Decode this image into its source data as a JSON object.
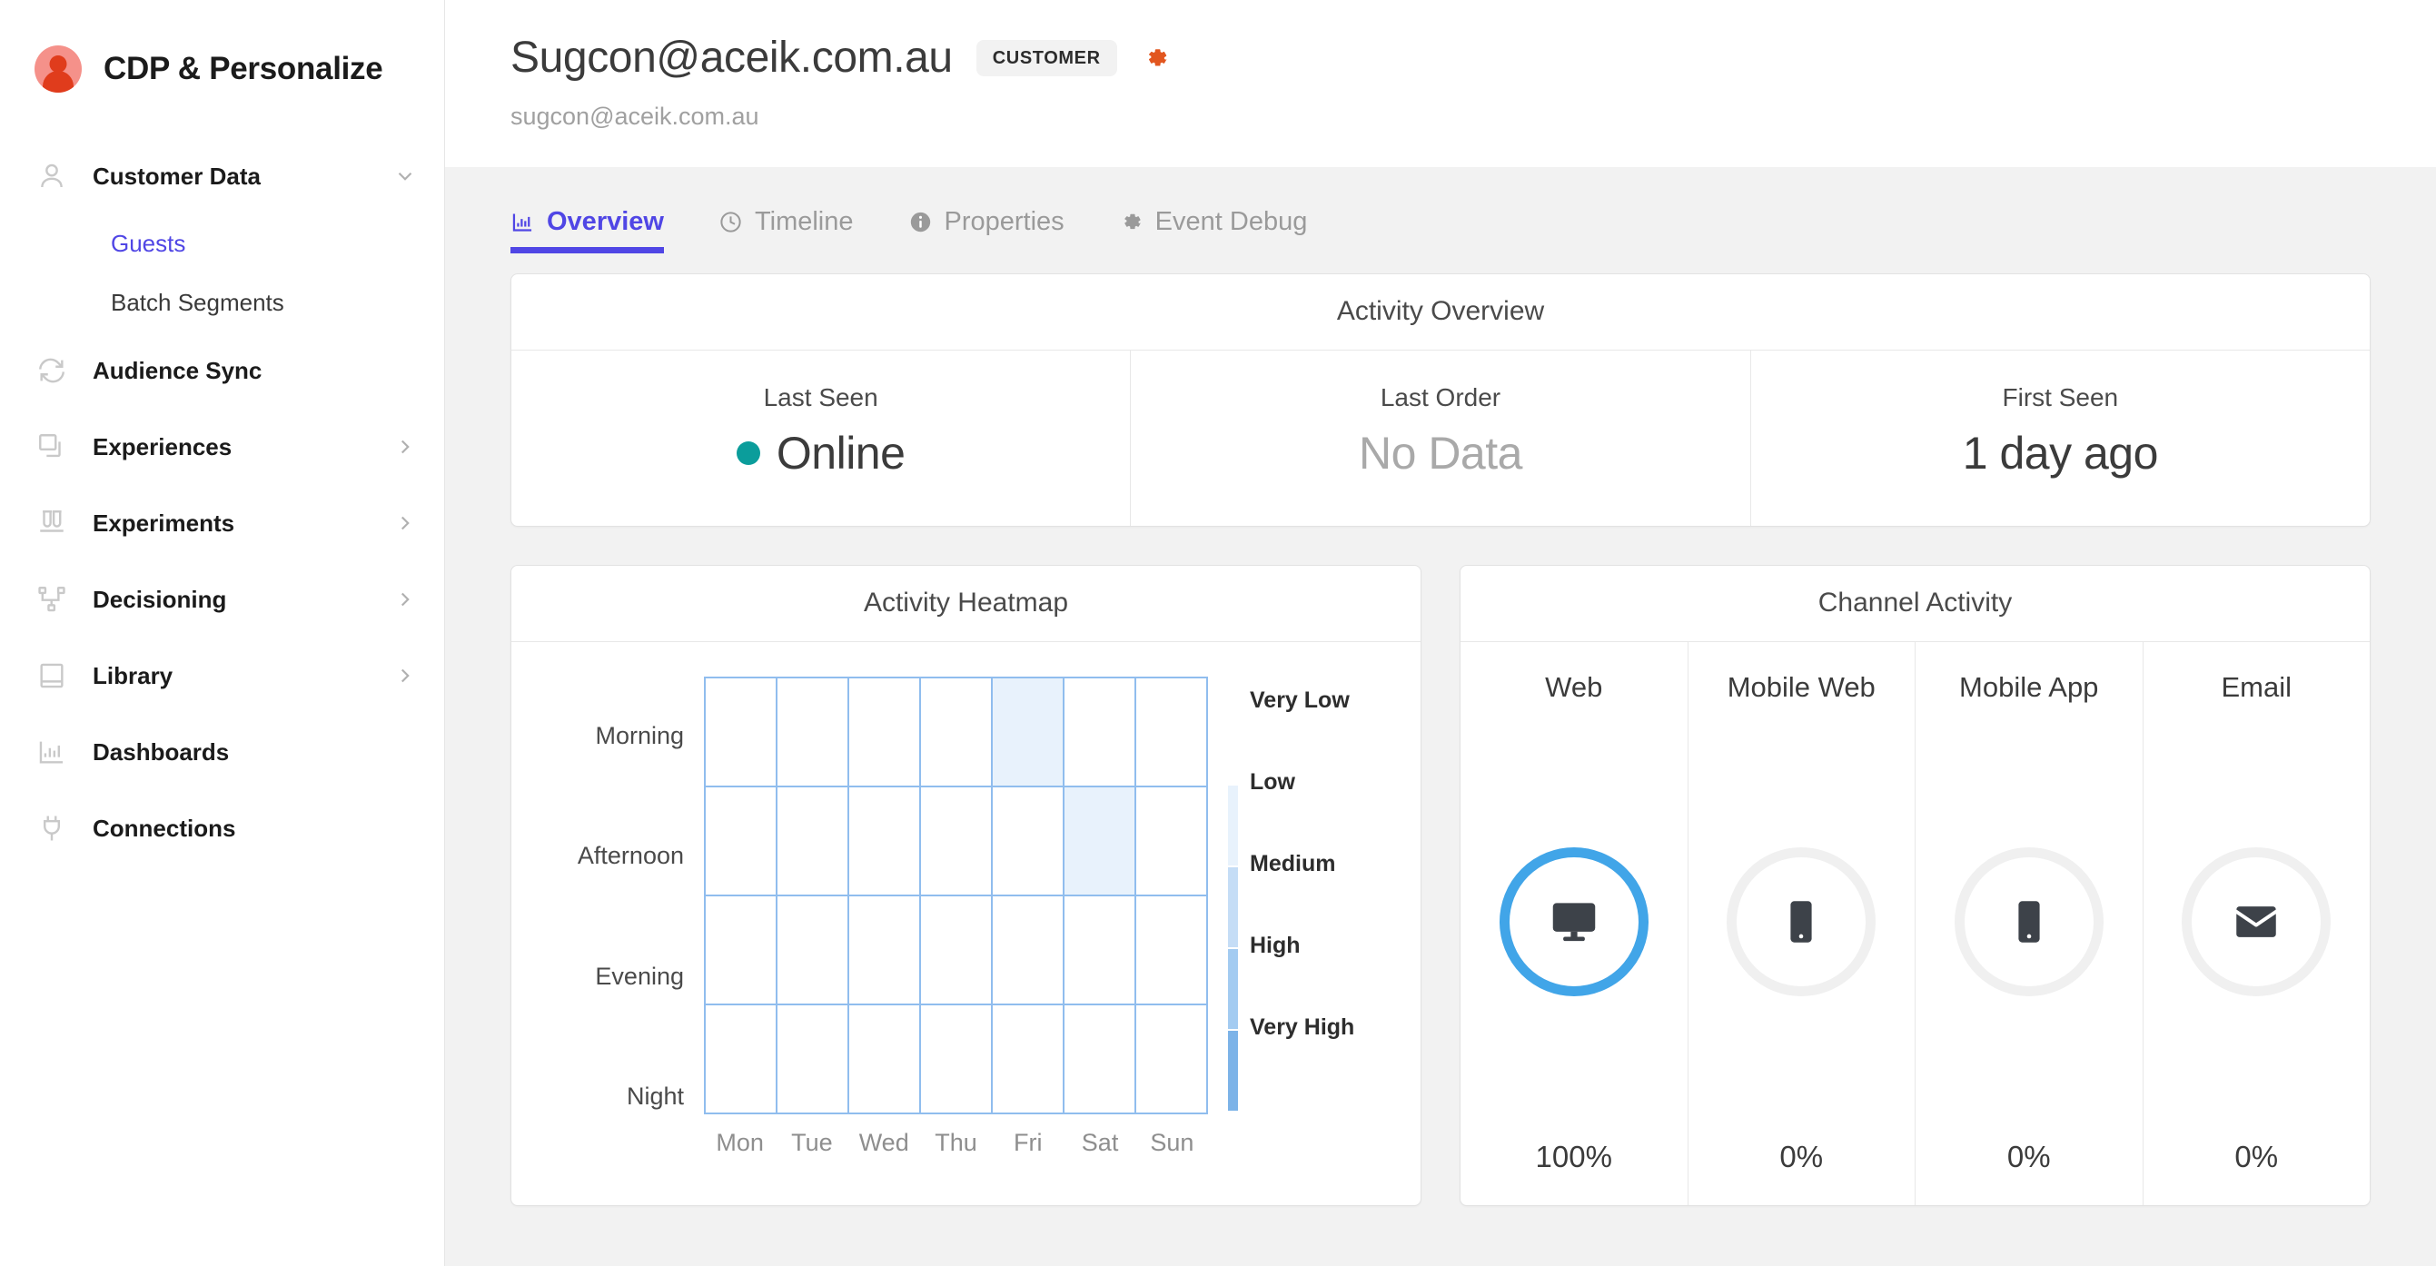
{
  "brand": {
    "name": "CDP & Personalize",
    "logo_icon": "person-in-circle-logo"
  },
  "sidebar": {
    "items": [
      {
        "label": "Customer Data",
        "icon": "user-icon",
        "chevron": "chevron-down-icon",
        "expanded": true
      },
      {
        "label": "Audience Sync",
        "icon": "sync-icon",
        "chevron": null
      },
      {
        "label": "Experiences",
        "icon": "layers-icon",
        "chevron": "chevron-right-icon"
      },
      {
        "label": "Experiments",
        "icon": "test-tubes-icon",
        "chevron": "chevron-right-icon"
      },
      {
        "label": "Decisioning",
        "icon": "node-tree-icon",
        "chevron": "chevron-right-icon"
      },
      {
        "label": "Library",
        "icon": "book-icon",
        "chevron": "chevron-right-icon"
      },
      {
        "label": "Dashboards",
        "icon": "bar-chart-icon",
        "chevron": null
      },
      {
        "label": "Connections",
        "icon": "plug-icon",
        "chevron": null
      }
    ],
    "sub_items": [
      {
        "label": "Guests",
        "active": true
      },
      {
        "label": "Batch Segments",
        "active": false
      }
    ]
  },
  "header": {
    "title": "Sugcon@aceik.com.au",
    "badge": "CUSTOMER",
    "gear_icon": "gear-icon",
    "subtitle": "sugcon@aceik.com.au"
  },
  "tabs": [
    {
      "label": "Overview",
      "icon": "bar-chart-icon",
      "active": true
    },
    {
      "label": "Timeline",
      "icon": "clock-icon",
      "active": false
    },
    {
      "label": "Properties",
      "icon": "info-icon",
      "active": false
    },
    {
      "label": "Event Debug",
      "icon": "gear-icon",
      "active": false
    }
  ],
  "activity_overview": {
    "title": "Activity Overview",
    "cells": [
      {
        "label": "Last Seen",
        "value": "Online",
        "muted": false,
        "dot": true,
        "dot_color": "#0b9d9b"
      },
      {
        "label": "Last Order",
        "value": "No Data",
        "muted": true,
        "dot": false
      },
      {
        "label": "First Seen",
        "value": "1 day ago",
        "muted": false,
        "dot": false
      }
    ]
  },
  "heatmap": {
    "title": "Activity Heatmap",
    "legend": [
      "Very Low",
      "Low",
      "Medium",
      "High",
      "Very High"
    ],
    "legend_colors": [
      "#e8f2fc",
      "#c5ddf6",
      "#a3cbf1",
      "#7cb3e8"
    ],
    "grid_line_color": "#90bdee",
    "active_cell_color": "#7cb3e8"
  },
  "channel_activity": {
    "title": "Channel Activity",
    "channels": [
      {
        "name": "Web",
        "icon": "desktop-monitor-icon",
        "percent": "100%",
        "active": true
      },
      {
        "name": "Mobile Web",
        "icon": "mobile-phone-icon",
        "percent": "0%",
        "active": false
      },
      {
        "name": "Mobile App",
        "icon": "mobile-phone-icon",
        "percent": "0%",
        "active": false
      },
      {
        "name": "Email",
        "icon": "envelope-icon",
        "percent": "0%",
        "active": false
      }
    ],
    "active_ring_color": "#41a5e8",
    "inactive_ring_color": "#f0f0f0"
  },
  "chart_data": {
    "type": "heatmap",
    "title": "Activity Heatmap",
    "xlabel": "",
    "ylabel": "",
    "categories": [
      "Mon",
      "Tue",
      "Wed",
      "Thu",
      "Fri",
      "Sat",
      "Sun"
    ],
    "rows": [
      "Morning",
      "Afternoon",
      "Evening",
      "Night"
    ],
    "values": [
      [
        0,
        0,
        0,
        0,
        1,
        0,
        0
      ],
      [
        0,
        0,
        0,
        0,
        0,
        1,
        0
      ],
      [
        0,
        0,
        0,
        0,
        0,
        0,
        0
      ],
      [
        0,
        0,
        0,
        0,
        0,
        0,
        0
      ]
    ],
    "scale_labels": [
      "Very Low",
      "Low",
      "Medium",
      "High",
      "Very High"
    ],
    "colormap": [
      "#ffffff",
      "#e8f2fc",
      "#c5ddf6",
      "#a3cbf1",
      "#7cb3e8"
    ],
    "grid": true,
    "legend_position": "right"
  }
}
